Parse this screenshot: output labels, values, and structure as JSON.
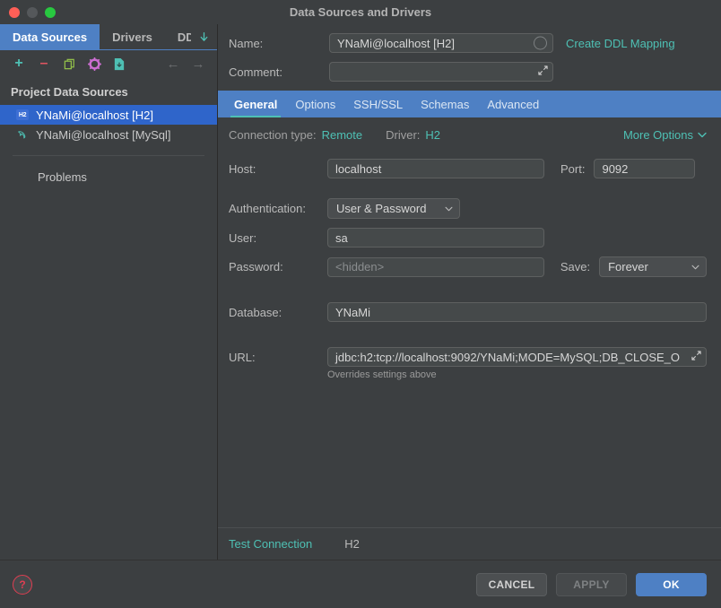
{
  "window": {
    "title": "Data Sources and Drivers",
    "controls": [
      "close-button",
      "minimize-button",
      "maximize-button"
    ]
  },
  "left_panel": {
    "tabs": [
      {
        "label": "Data Sources",
        "active": true
      },
      {
        "label": "Drivers",
        "active": false
      },
      {
        "label": "DD",
        "active": false
      }
    ],
    "overflow_icon": "chevron-down-icon",
    "toolbar": [
      {
        "name": "add-button",
        "glyph": "+",
        "color": "#4ec0b4"
      },
      {
        "name": "remove-button",
        "glyph": "–",
        "color": "#e05561"
      },
      {
        "name": "copy-button",
        "glyph": "⧉",
        "color": "#94c24a"
      },
      {
        "name": "settings-button",
        "glyph": "⚙",
        "color": "#cb6ed0"
      },
      {
        "name": "import-file-button",
        "glyph": "❐",
        "color": "#4ec0b4"
      },
      {
        "name": "back-button",
        "glyph": "←",
        "color": "#6e7072"
      },
      {
        "name": "forward-button",
        "glyph": "→",
        "color": "#6e7072"
      }
    ],
    "group_header": "Project Data Sources",
    "items": [
      {
        "label": "YNaMi@localhost [H2]",
        "icon": "h2-database-icon",
        "selected": true
      },
      {
        "label": "YNaMi@localhost [MySql]",
        "icon": "mysql-dolphin-icon",
        "selected": false
      }
    ],
    "problems_label": "Problems"
  },
  "header": {
    "name_label": "Name:",
    "name_value": "YNaMi@localhost [H2]",
    "name_badge": "color-indicator-icon",
    "comment_label": "Comment:",
    "comment_value": "",
    "comment_expand_icon": "expand-icon",
    "create_ddl_link": "Create DDL Mapping"
  },
  "tabs": [
    {
      "label": "General",
      "active": true
    },
    {
      "label": "Options",
      "active": false
    },
    {
      "label": "SSH/SSL",
      "active": false
    },
    {
      "label": "Schemas",
      "active": false
    },
    {
      "label": "Advanced",
      "active": false
    }
  ],
  "general": {
    "connection_type_label": "Connection type:",
    "connection_type_value": "Remote",
    "driver_label": "Driver:",
    "driver_value": "H2",
    "more_options_label": "More Options",
    "more_options_icon": "chevron-down-icon",
    "host_label": "Host:",
    "host_value": "localhost",
    "port_label": "Port:",
    "port_value": "9092",
    "auth_label": "Authentication:",
    "auth_value": "User & Password",
    "user_label": "User:",
    "user_value": "sa",
    "password_label": "Password:",
    "password_placeholder": "<hidden>",
    "save_label": "Save:",
    "save_value": "Forever",
    "database_label": "Database:",
    "database_value": "YNaMi",
    "url_label": "URL:",
    "url_value": "jdbc:h2:tcp://localhost:9092/YNaMi;MODE=MySQL;DB_CLOSE_O",
    "url_expand_icon": "expand-icon",
    "url_hint": "Overrides settings above"
  },
  "test_strip": {
    "test_connection_label": "Test Connection",
    "driver_name": "H2"
  },
  "footer": {
    "help_icon": "help-question-icon",
    "help_glyph": "?",
    "cancel_label": "CANCEL",
    "apply_label": "APPLY",
    "ok_label": "OK"
  },
  "colors": {
    "accent_teal": "#4ec0b4",
    "accent_blue": "#4e80c4",
    "selection_blue": "#2f65ca",
    "background": "#3c3f41",
    "field_background": "#45494a",
    "help_red": "#e03e52"
  }
}
